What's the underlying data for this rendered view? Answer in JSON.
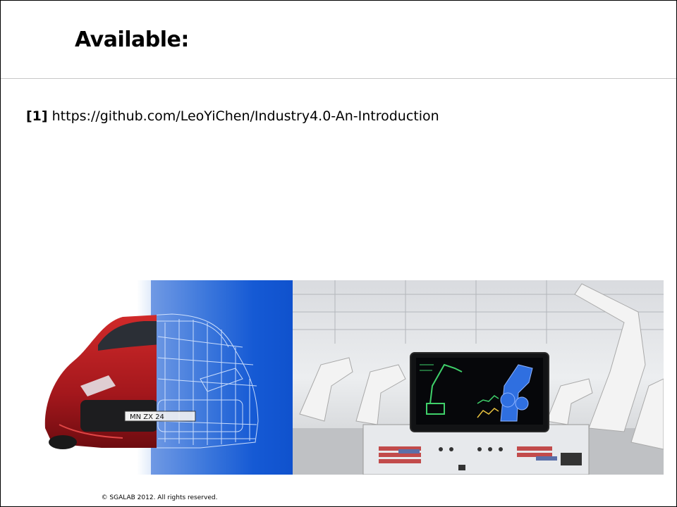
{
  "slide": {
    "title": "Available:",
    "reference": {
      "number": "[1]",
      "url": "https://github.com/LeoYiChen/Industry4.0-An-Introduction"
    },
    "car_image": {
      "plate_text": "MN ZX 24"
    },
    "footer": "© SGALAB 2012. All rights reserved."
  }
}
